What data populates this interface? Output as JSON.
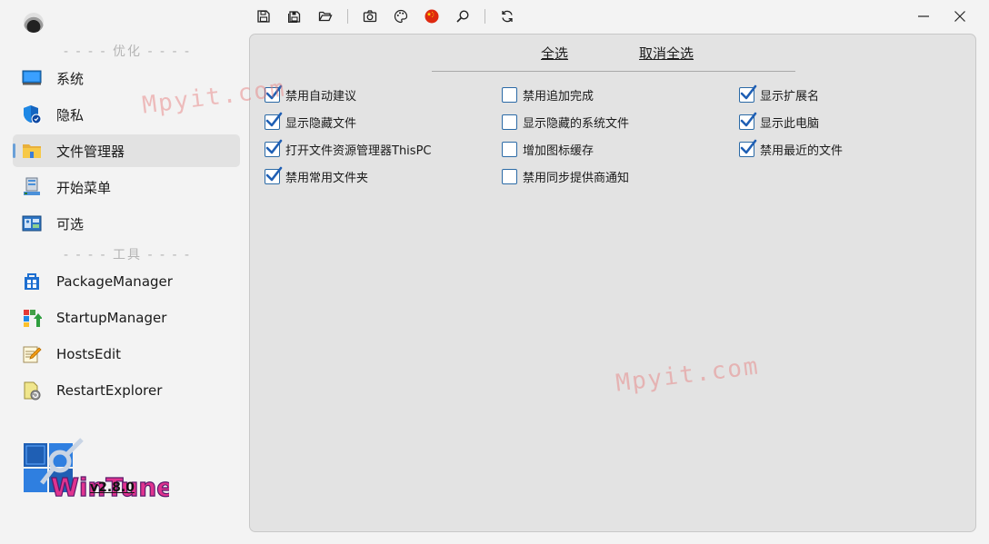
{
  "toolbar": {
    "icons": [
      "save-icon",
      "save-all-icon",
      "folder-open-icon",
      "camera-icon",
      "palette-icon",
      "china-flag-icon",
      "search-icon",
      "refresh-icon"
    ]
  },
  "window": {
    "controls": [
      "minimize-icon",
      "close-icon"
    ]
  },
  "sidebar": {
    "section_optimize": "- - - - 优化 - - - -",
    "section_tools": "- - - - 工具 - - - -",
    "items": [
      {
        "label": "系统",
        "icon": "monitor-icon"
      },
      {
        "label": "隐私",
        "icon": "shield-icon"
      },
      {
        "label": "文件管理器",
        "icon": "folder-icon",
        "active": true
      },
      {
        "label": "开始菜单",
        "icon": "start-menu-icon"
      },
      {
        "label": "可选",
        "icon": "settings-panel-icon"
      },
      {
        "label": "PackageManager",
        "icon": "package-icon"
      },
      {
        "label": "StartupManager",
        "icon": "startup-icon"
      },
      {
        "label": "HostsEdit",
        "icon": "edit-note-icon"
      },
      {
        "label": "RestartExplorer",
        "icon": "restart-explorer-icon"
      }
    ],
    "version": "v2.8.0",
    "logo_text": "WinTune"
  },
  "content": {
    "select_all": "全选",
    "deselect_all": "取消全选",
    "options": [
      [
        {
          "label": "禁用自动建议",
          "checked": true
        },
        {
          "label": "显示隐藏文件",
          "checked": true
        },
        {
          "label": "打开文件资源管理器ThisPC",
          "checked": true
        },
        {
          "label": "禁用常用文件夹",
          "checked": true
        }
      ],
      [
        {
          "label": "禁用追加完成",
          "checked": false
        },
        {
          "label": "显示隐藏的系统文件",
          "checked": false
        },
        {
          "label": "增加图标缓存",
          "checked": false
        },
        {
          "label": "禁用同步提供商通知",
          "checked": false
        }
      ],
      [
        {
          "label": "显示扩展名",
          "checked": true
        },
        {
          "label": "显示此电脑",
          "checked": true
        },
        {
          "label": "禁用最近的文件",
          "checked": true
        }
      ]
    ]
  },
  "watermarks": [
    "Mpyit.com",
    "Mpyit.com"
  ]
}
